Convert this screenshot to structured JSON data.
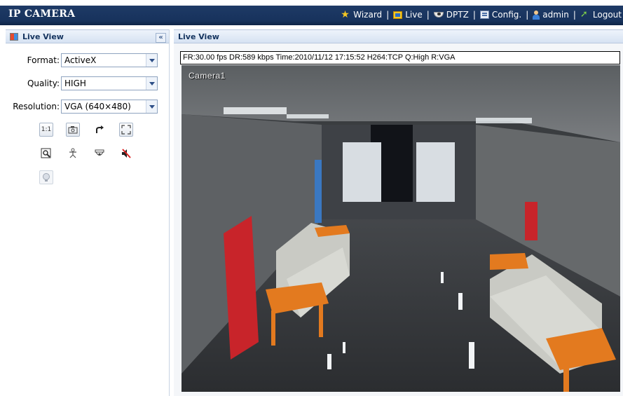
{
  "app": {
    "title": "IP CAMERA"
  },
  "nav": {
    "wizard": "Wizard",
    "live": "Live",
    "dptz": "DPTZ",
    "config": "Config.",
    "user": "admin",
    "logout": "Logout",
    "separator": "|"
  },
  "left_panel": {
    "title": "Live View",
    "collapse_label": "«",
    "format": {
      "label": "Format:",
      "value": "ActiveX"
    },
    "quality": {
      "label": "Quality:",
      "value": "HIGH"
    },
    "resolution": {
      "label": "Resolution:",
      "value": "VGA (640×480)"
    },
    "tools": {
      "original_size": "1:1"
    }
  },
  "right_panel": {
    "title": "Live View",
    "status": "FR:30.00 fps  DR:589 kbps Time:2010/11/12 17:15:52 H264:TCP Q:High R:VGA",
    "camera_label": "Camera1"
  },
  "colors": {
    "topbar": "#17325c",
    "panel_header": "#d6e2f2",
    "accent_yellow": "#f3c623"
  }
}
